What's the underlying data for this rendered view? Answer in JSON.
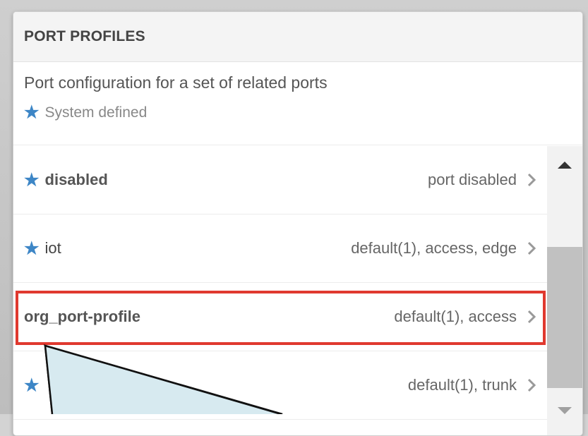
{
  "panel": {
    "title": "PORT PROFILES",
    "description": "Port configuration for a set of related ports",
    "legend_label": "System defined",
    "legend_icon": "star-icon"
  },
  "profiles": [
    {
      "name": "disabled",
      "detail": "port disabled",
      "system_defined": true
    },
    {
      "name": "iot",
      "detail": "default(1), access, edge",
      "system_defined": true
    },
    {
      "name": "org_port-profile",
      "detail": "default(1), access",
      "system_defined": false,
      "highlighted": true
    },
    {
      "name": "",
      "detail": "default(1), trunk",
      "system_defined": true
    }
  ],
  "colors": {
    "accent_star": "#3d86c6",
    "highlight_border": "#e0392f",
    "callout_fill": "#d7eaf0"
  }
}
